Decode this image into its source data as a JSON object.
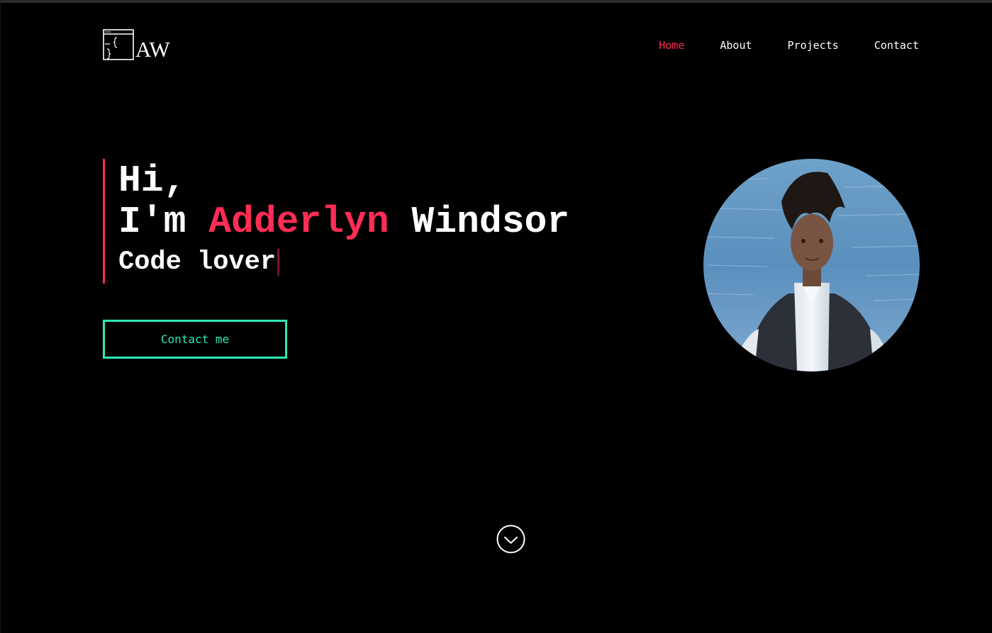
{
  "header": {
    "logo_text": "AW",
    "nav": [
      {
        "label": "Home",
        "active": true
      },
      {
        "label": "About",
        "active": false
      },
      {
        "label": "Projects",
        "active": false
      },
      {
        "label": "Contact",
        "active": false
      }
    ]
  },
  "hero": {
    "greeting": "Hi,",
    "intro": "I'm",
    "first_name": "Adderlyn",
    "last_name": "Windsor",
    "role": "Code lover",
    "cta_label": "Contact me"
  },
  "icons": {
    "logo": "code-window-icon",
    "scroll": "chevron-down-circle-icon"
  },
  "colors": {
    "background": "#000000",
    "accent": "#ff2d55",
    "cta": "#2ee8b6",
    "text": "#ffffff"
  }
}
